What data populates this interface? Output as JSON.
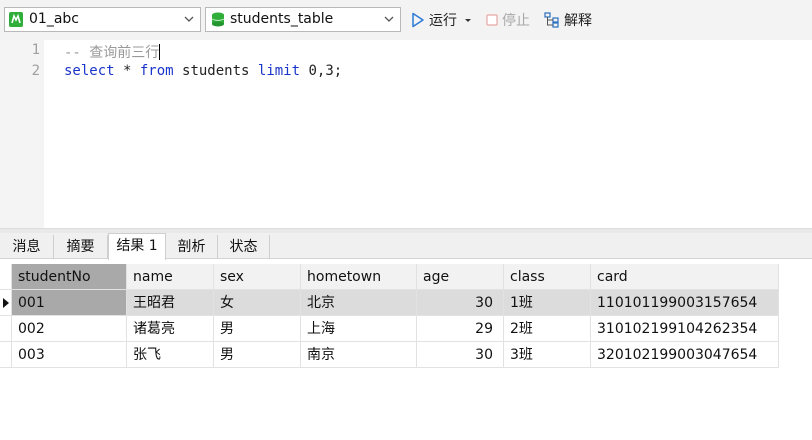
{
  "toolbar": {
    "connection_value": "01_abc",
    "table_value": "students_table",
    "run_label": "运行",
    "stop_label": "停止",
    "explain_label": "解释"
  },
  "editor": {
    "line_numbers": [
      "1",
      "2"
    ],
    "line1_comment": "-- 查询前三行",
    "line2_kw_select": "select",
    "line2_star": " * ",
    "line2_kw_from": "from",
    "line2_table": " students ",
    "line2_kw_limit": "limit",
    "line2_args": " 0,3;"
  },
  "tabs": [
    "消息",
    "摘要",
    "结果 1",
    "剖析",
    "状态"
  ],
  "active_tab": "结果 1",
  "result": {
    "columns": [
      "studentNo",
      "name",
      "sex",
      "hometown",
      "age",
      "class",
      "card"
    ],
    "rows": [
      [
        "001",
        "王昭君",
        "女",
        "北京",
        "30",
        "1班",
        "110101199003157654"
      ],
      [
        "002",
        "诸葛亮",
        "男",
        "上海",
        "29",
        "2班",
        "310102199104262354"
      ],
      [
        "003",
        "张飞",
        "男",
        "南京",
        "30",
        "3班",
        "320102199003047654"
      ]
    ],
    "selected_row": 0
  },
  "colors": {
    "keyword": "#1a35c9",
    "comment": "#9a9a9a",
    "run_icon": "#2a7ad6"
  },
  "icons": {
    "connection": "mysql-connection-icon",
    "table": "database-icon",
    "run": "play-icon",
    "stop": "stop-icon",
    "explain": "explain-icon"
  }
}
